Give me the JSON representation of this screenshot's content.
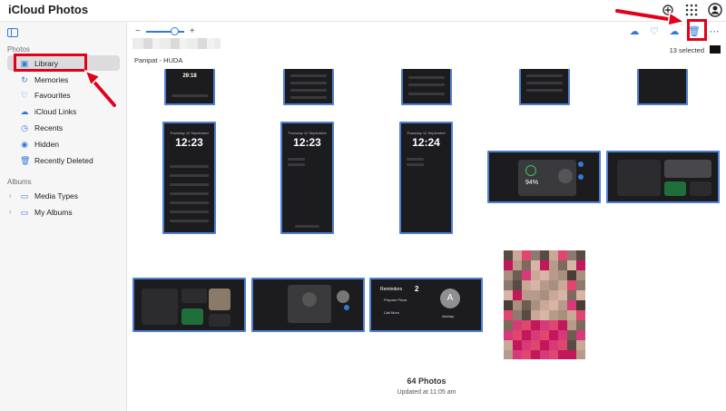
{
  "app": {
    "title": "iCloud Photos"
  },
  "sidebar": {
    "photos_label": "Photos",
    "items": [
      {
        "label": "Library",
        "icon": "library-icon"
      },
      {
        "label": "Memories",
        "icon": "memories-icon"
      },
      {
        "label": "Favourites",
        "icon": "heart-icon"
      },
      {
        "label": "iCloud Links",
        "icon": "link-icon"
      },
      {
        "label": "Recents",
        "icon": "clock-icon"
      },
      {
        "label": "Hidden",
        "icon": "eye-icon"
      },
      {
        "label": "Recently Deleted",
        "icon": "trash-icon"
      }
    ],
    "albums_label": "Albums",
    "albums": [
      {
        "label": "Media Types",
        "icon": "folder-icon"
      },
      {
        "label": "My Albums",
        "icon": "folder-icon"
      }
    ]
  },
  "main": {
    "zoom_minus": "−",
    "zoom_plus": "+",
    "zoom_level": 0.75,
    "location": "Panipat - HUDA",
    "selected_text": "13 selected",
    "footer_count": "64 Photos",
    "footer_updated": "Updated at 11:05 am",
    "tiles": [
      {
        "clock": "12:23"
      },
      {
        "clock": "12:23"
      },
      {
        "clock": "12:24"
      }
    ],
    "top_row_tile_time": "29:18",
    "widget_percent": "94%",
    "reminders": {
      "title": "Reminders",
      "count": "2",
      "item1": "Prepare Pizza",
      "item2": "Call Mom",
      "avatar_letter": "A",
      "avatar_name": "Akshay"
    }
  },
  "colors": {
    "accent": "#2f7bd6",
    "highlight": "#e3001b",
    "tile_border": "#4f7fd3"
  }
}
